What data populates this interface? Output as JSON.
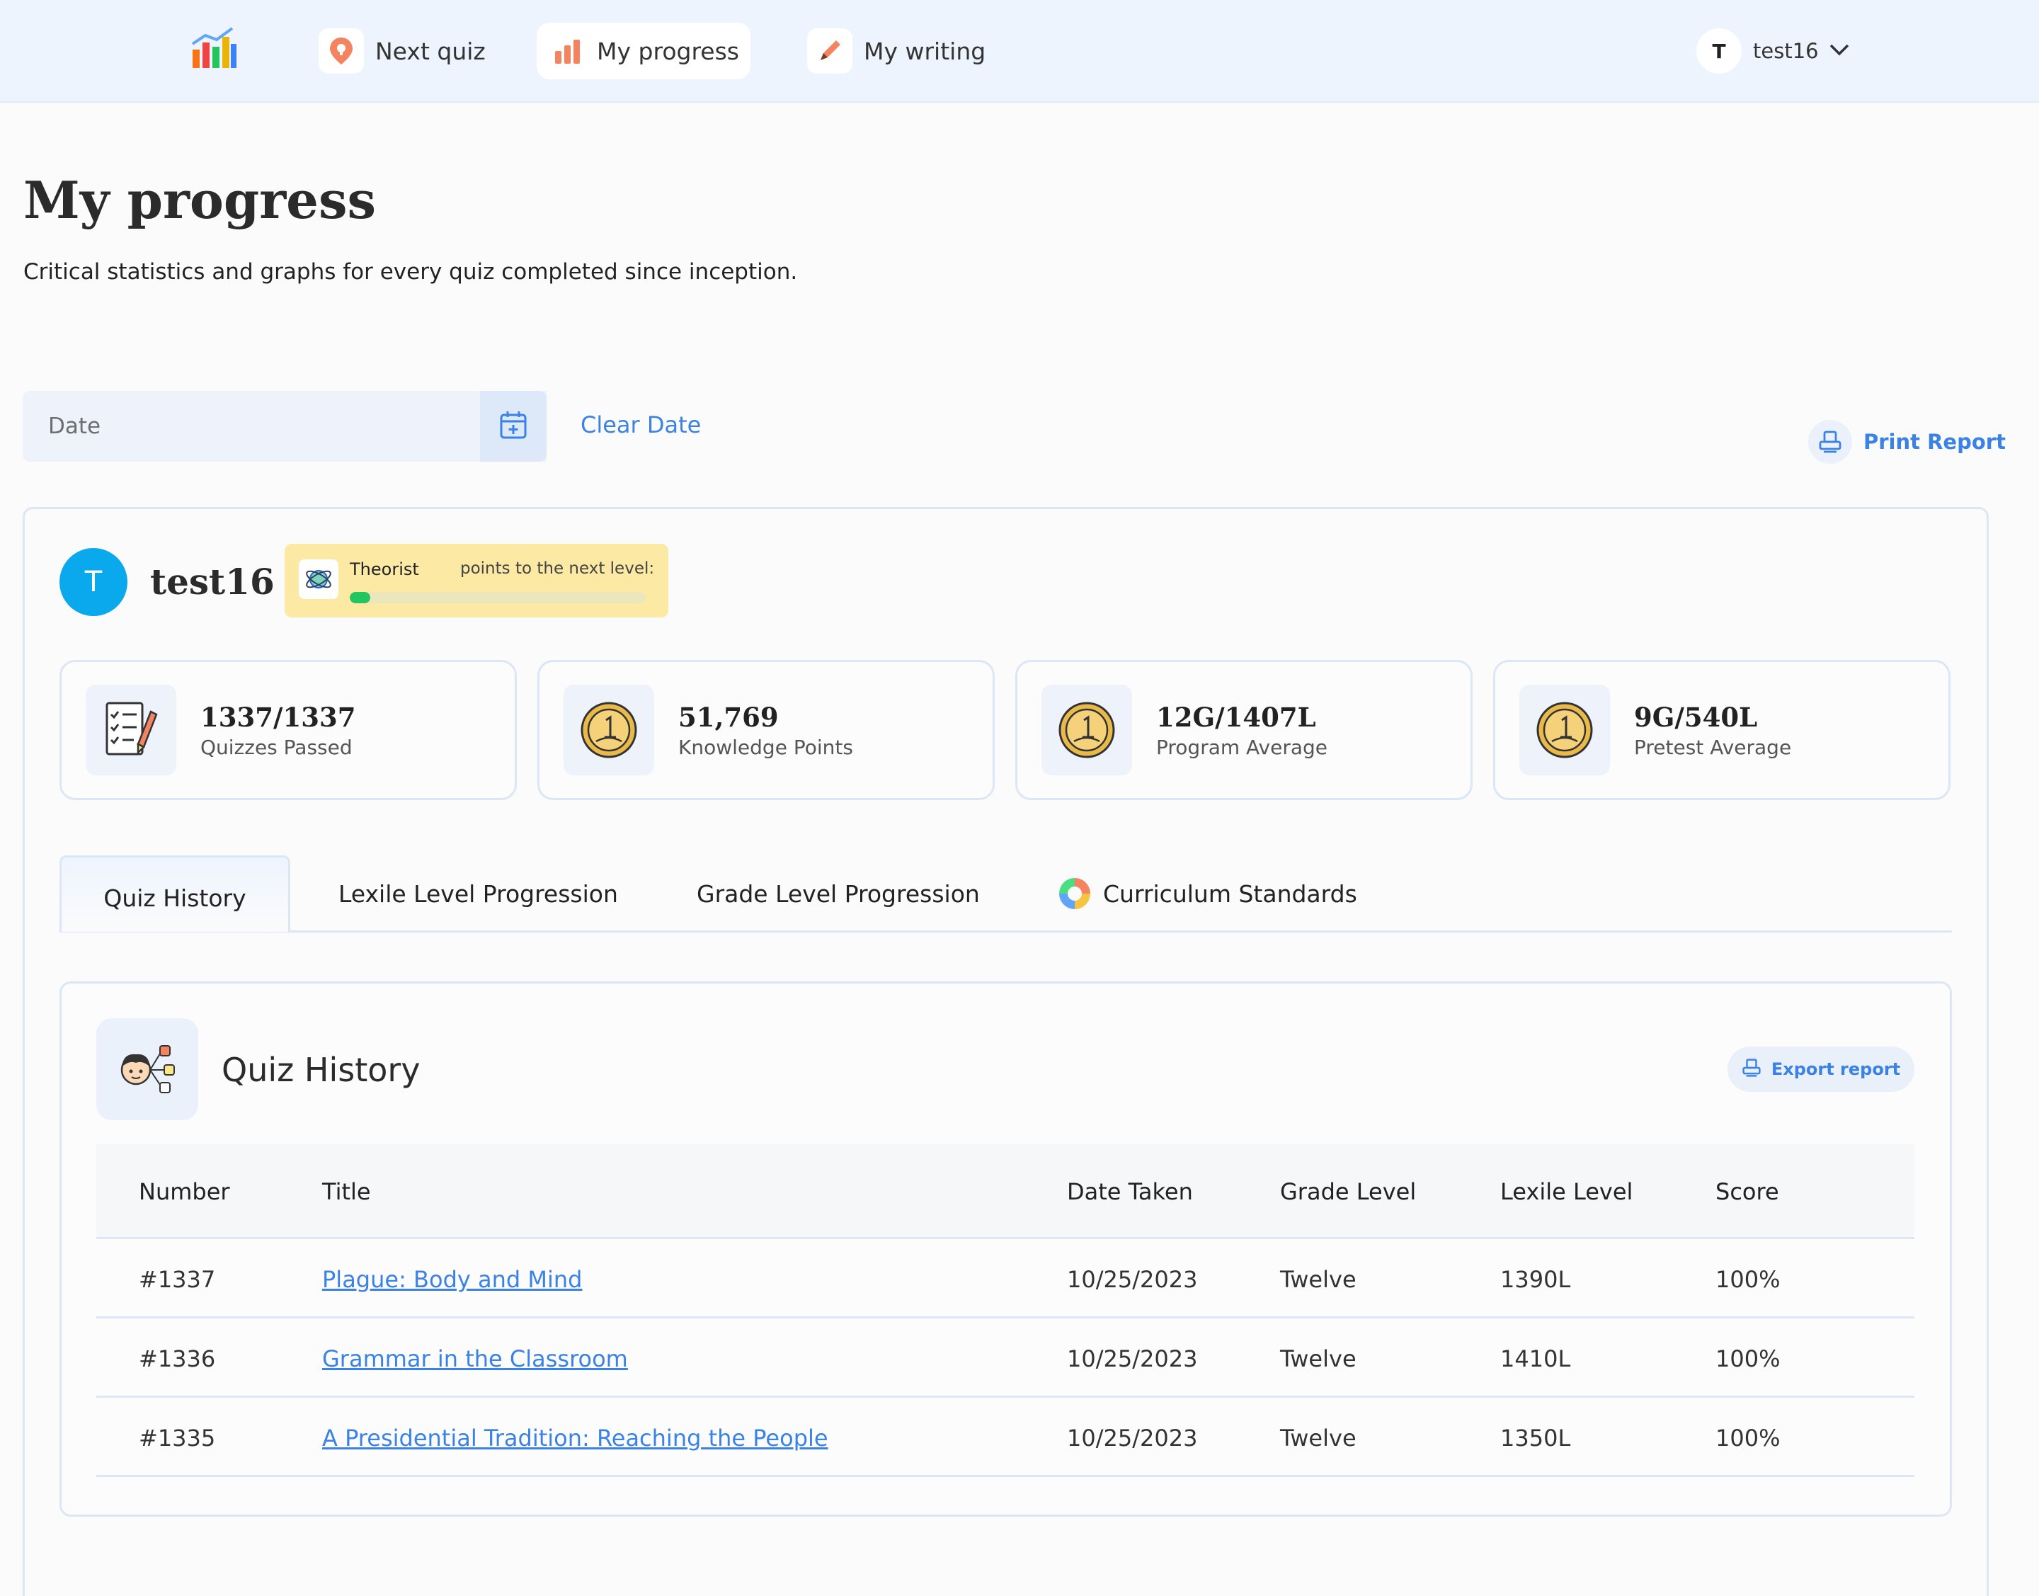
{
  "nav": {
    "items": [
      {
        "label": "Next quiz",
        "icon": "lightbulb-pin-icon"
      },
      {
        "label": "My progress",
        "icon": "bar-chart-icon"
      },
      {
        "label": "My writing",
        "icon": "pencil-icon"
      }
    ],
    "user": {
      "initial": "T",
      "name": "test16"
    }
  },
  "header": {
    "title": "My progress",
    "subtitle": "Critical statistics and graphs for every quiz completed since inception."
  },
  "filter": {
    "date_placeholder": "Date",
    "clear_label": "Clear Date",
    "print_label": "Print Report"
  },
  "profile": {
    "initial": "T",
    "name": "test16",
    "level": {
      "name": "Theorist",
      "next_label": "points to the next level:",
      "progress": 0.07
    }
  },
  "stats": [
    {
      "value": "1337/1337",
      "label": "Quizzes Passed",
      "icon": "checklist-icon"
    },
    {
      "value": "51,769",
      "label": "Knowledge Points",
      "icon": "gold-coin-icon"
    },
    {
      "value": "12G/1407L",
      "label": "Program Average",
      "icon": "gold-coin-icon"
    },
    {
      "value": "9G/540L",
      "label": "Pretest Average",
      "icon": "gold-coin-icon"
    }
  ],
  "tabs": [
    {
      "label": "Quiz History",
      "active": true
    },
    {
      "label": "Lexile Level Progression"
    },
    {
      "label": "Grade Level Progression"
    },
    {
      "label": "Curriculum Standards",
      "icon": "pie-chart-icon"
    }
  ],
  "history": {
    "title": "Quiz History",
    "export_label": "Export report",
    "columns": [
      "Number",
      "Title",
      "Date Taken",
      "Grade Level",
      "Lexile Level",
      "Score"
    ],
    "rows": [
      {
        "number": "#1337",
        "title": "Plague: Body and Mind",
        "date": "10/25/2023",
        "grade": "Twelve",
        "lexile": "1390L",
        "score": "100%"
      },
      {
        "number": "#1336",
        "title": "Grammar in the Classroom",
        "date": "10/25/2023",
        "grade": "Twelve",
        "lexile": "1410L",
        "score": "100%"
      },
      {
        "number": "#1335",
        "title": "A Presidential Tradition: Reaching the People",
        "date": "10/25/2023",
        "grade": "Twelve",
        "lexile": "1350L",
        "score": "100%"
      }
    ]
  },
  "colors": {
    "accent": "#3b82e6",
    "avatar": "#0aa9ee",
    "badge": "#fbe9a4",
    "progress": "#22c55e",
    "nav_bg": "#eef4fe"
  }
}
